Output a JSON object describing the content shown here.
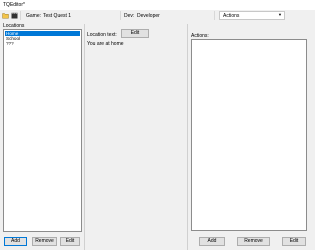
{
  "window": {
    "title": "TQEditor*"
  },
  "toolbar": {
    "game_label": "Game:",
    "game_name": "Test Quest 1",
    "dev_label": "Dev:",
    "dev_name": "Developer",
    "actions_dropdown": "Actions"
  },
  "locations": {
    "header": "Locations",
    "items": [
      "Home",
      "School",
      "???"
    ],
    "selected_index": 0,
    "add_label": "Add",
    "remove_label": "Remove",
    "edit_label": "Edit"
  },
  "location_text": {
    "label": "Location text:",
    "edit_label": "Edit",
    "value": "You are at home"
  },
  "actions": {
    "header": "Actions:",
    "add_label": "Add",
    "remove_label": "Remove",
    "edit_label": "Edit"
  }
}
